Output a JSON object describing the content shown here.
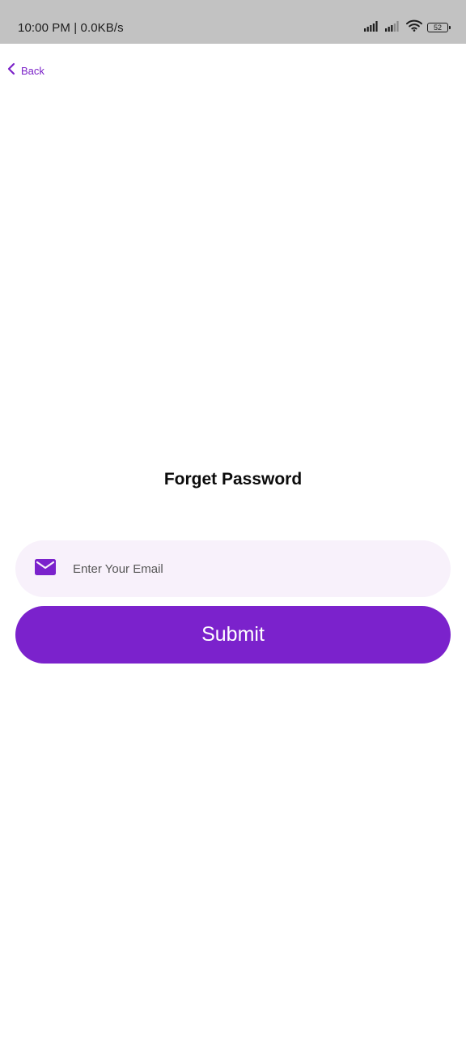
{
  "status_bar": {
    "time_and_speed": "10:00 PM | 0.0KB/s",
    "battery_level": "52",
    "icons": [
      "signal-icon",
      "signal-icon",
      "wifi-icon",
      "battery-icon"
    ]
  },
  "nav": {
    "back_label": "Back",
    "back_icon": "chevron-left-icon"
  },
  "page": {
    "title": "Forget Password"
  },
  "form": {
    "email_icon": "mail-icon",
    "email_placeholder": "Enter Your Email",
    "email_value": "",
    "submit_label": "Submit"
  },
  "colors": {
    "accent": "#7b22cc",
    "field_background": "#f8f1fb",
    "status_bar_background": "#c2c2c2"
  }
}
